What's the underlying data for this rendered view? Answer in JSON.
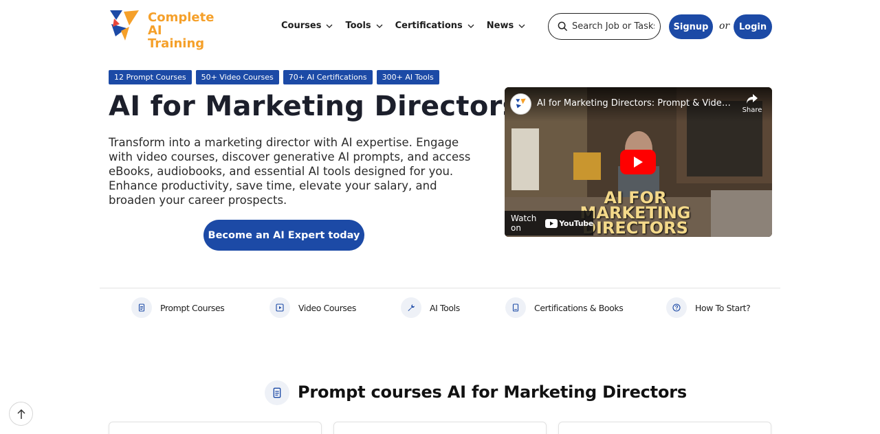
{
  "brand": {
    "line1": "Complete",
    "line2": "AI Training"
  },
  "nav": [
    {
      "label": "Courses"
    },
    {
      "label": "Tools"
    },
    {
      "label": "Certifications"
    },
    {
      "label": "News"
    }
  ],
  "search": {
    "placeholder": "Search Job or Tasks"
  },
  "auth": {
    "signup": "Signup",
    "or": "or",
    "login": "Login"
  },
  "hero": {
    "tags": [
      "12 Prompt Courses",
      "50+ Video Courses",
      "70+ AI Certifications",
      "300+ AI Tools"
    ],
    "title": "AI for Marketing Directors",
    "description": "Transform into a marketing director with AI expertise. Engage with video courses, discover generative AI prompts, and access eBooks, audiobooks, and essential AI tools designed for you. Enhance productivity, save time, elevate your salary, and broaden your career prospects.",
    "cta": "Become an AI Expert today"
  },
  "video": {
    "title": "AI for Marketing Directors: Prompt & Video co...",
    "share": "Share",
    "overlay_line1": "AI FOR MARKETING",
    "overlay_line2": "DIRECTORS",
    "watch_on": "Watch on",
    "youtube": "YouTube"
  },
  "categories": [
    {
      "label": "Prompt Courses",
      "icon": "document-icon"
    },
    {
      "label": "Video Courses",
      "icon": "play-icon"
    },
    {
      "label": "AI Tools",
      "icon": "wrench-icon"
    },
    {
      "label": "Certifications & Books",
      "icon": "book-icon"
    },
    {
      "label": "How To Start?",
      "icon": "question-icon"
    }
  ],
  "section": {
    "title": "Prompt courses AI for Marketing Directors"
  },
  "colors": {
    "primary": "#1c4aa6",
    "brand_orange": "#f5a02a",
    "brand_blue": "#1c4aa6"
  }
}
